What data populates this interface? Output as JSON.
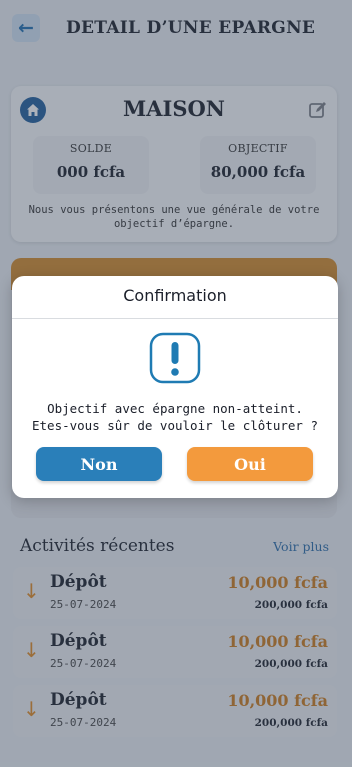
{
  "header": {
    "title": "DETAIL D’UNE EPARGNE",
    "back_icon": "arrow-left-icon"
  },
  "goal": {
    "name": "MAISON",
    "balance_label": "SOLDE",
    "balance_value": "000 fcfa",
    "target_label": "OBJECTIF",
    "target_value": "80,000 fcfa",
    "description": "Nous vous présentons une vue générale de votre objectif d’épargne."
  },
  "activities": {
    "title": "Activités récentes",
    "see_more": "Voir plus",
    "items": [
      {
        "type": "Dépôt",
        "date": "25-07-2024",
        "amount": "10,000 fcfa",
        "total": "200,000 fcfa"
      },
      {
        "type": "Dépôt",
        "date": "25-07-2024",
        "amount": "10,000 fcfa",
        "total": "200,000 fcfa"
      },
      {
        "type": "Dépôt",
        "date": "25-07-2024",
        "amount": "10,000 fcfa",
        "total": "200,000 fcfa"
      }
    ]
  },
  "dialog": {
    "title": "Confirmation",
    "message_line1": "Objectif avec épargne non-atteint.",
    "message_line2": "Etes-vous sûr de vouloir le clôturer ?",
    "no_label": "Non",
    "yes_label": "Oui"
  },
  "colors": {
    "primary": "#2a7fb9",
    "accent": "#f39a3d",
    "amount": "#cc7b1c"
  }
}
